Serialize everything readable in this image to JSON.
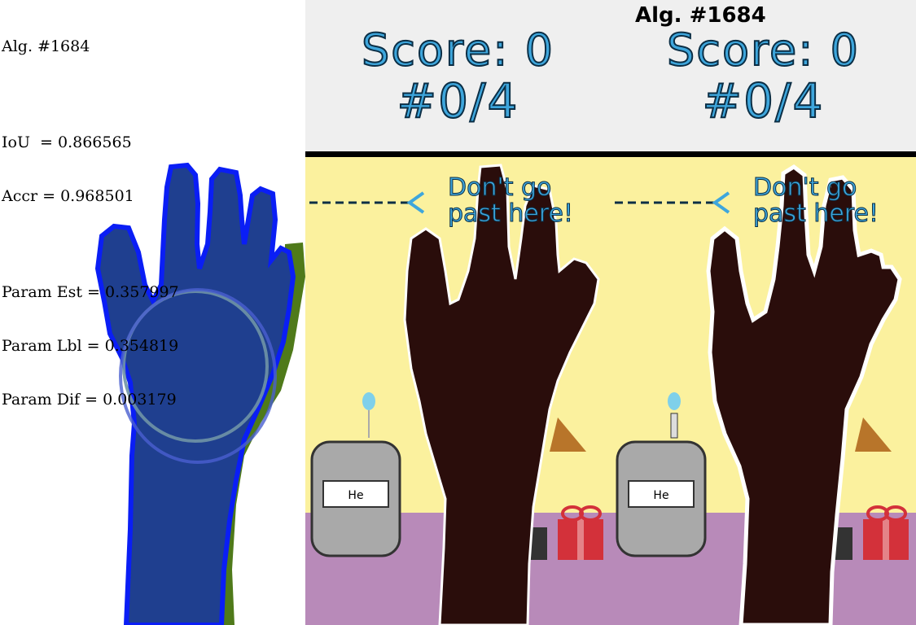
{
  "left_panel": {
    "algorithm_label": "Alg. #1684",
    "iou_text": "IoU  = 0.866565",
    "accr_text": "Accr = 0.968501",
    "param_est_text": "Param Est = 0.357997",
    "param_lbl_text": "Param Lbl = 0.354819",
    "param_dif_text": "Param Dif = 0.003179",
    "colors": {
      "estimate": "#1f3f8f",
      "estimate_edge": "#0a1ef5",
      "label_only": "#4f7a1a"
    }
  },
  "header": {
    "algorithm_label": "Alg. #1684",
    "left": {
      "score_text": "Score: 0",
      "round_text": "#0/4"
    },
    "right": {
      "score_text": "Score: 0",
      "round_text": "#0/4"
    },
    "score_color": "#3ea6dc"
  },
  "game_panels": [
    {
      "warning_line1": "Don't go",
      "warning_line2": "past here!",
      "jug_label": "He",
      "outline": "dashed"
    },
    {
      "warning_line1": "Don't go",
      "warning_line2": "past here!",
      "jug_label": "He",
      "outline": "solid"
    }
  ],
  "scene_colors": {
    "wall": "#fbf19e",
    "floor": "#b88ab9",
    "gift": "#d3313a",
    "hand": "#2a0d0b"
  }
}
